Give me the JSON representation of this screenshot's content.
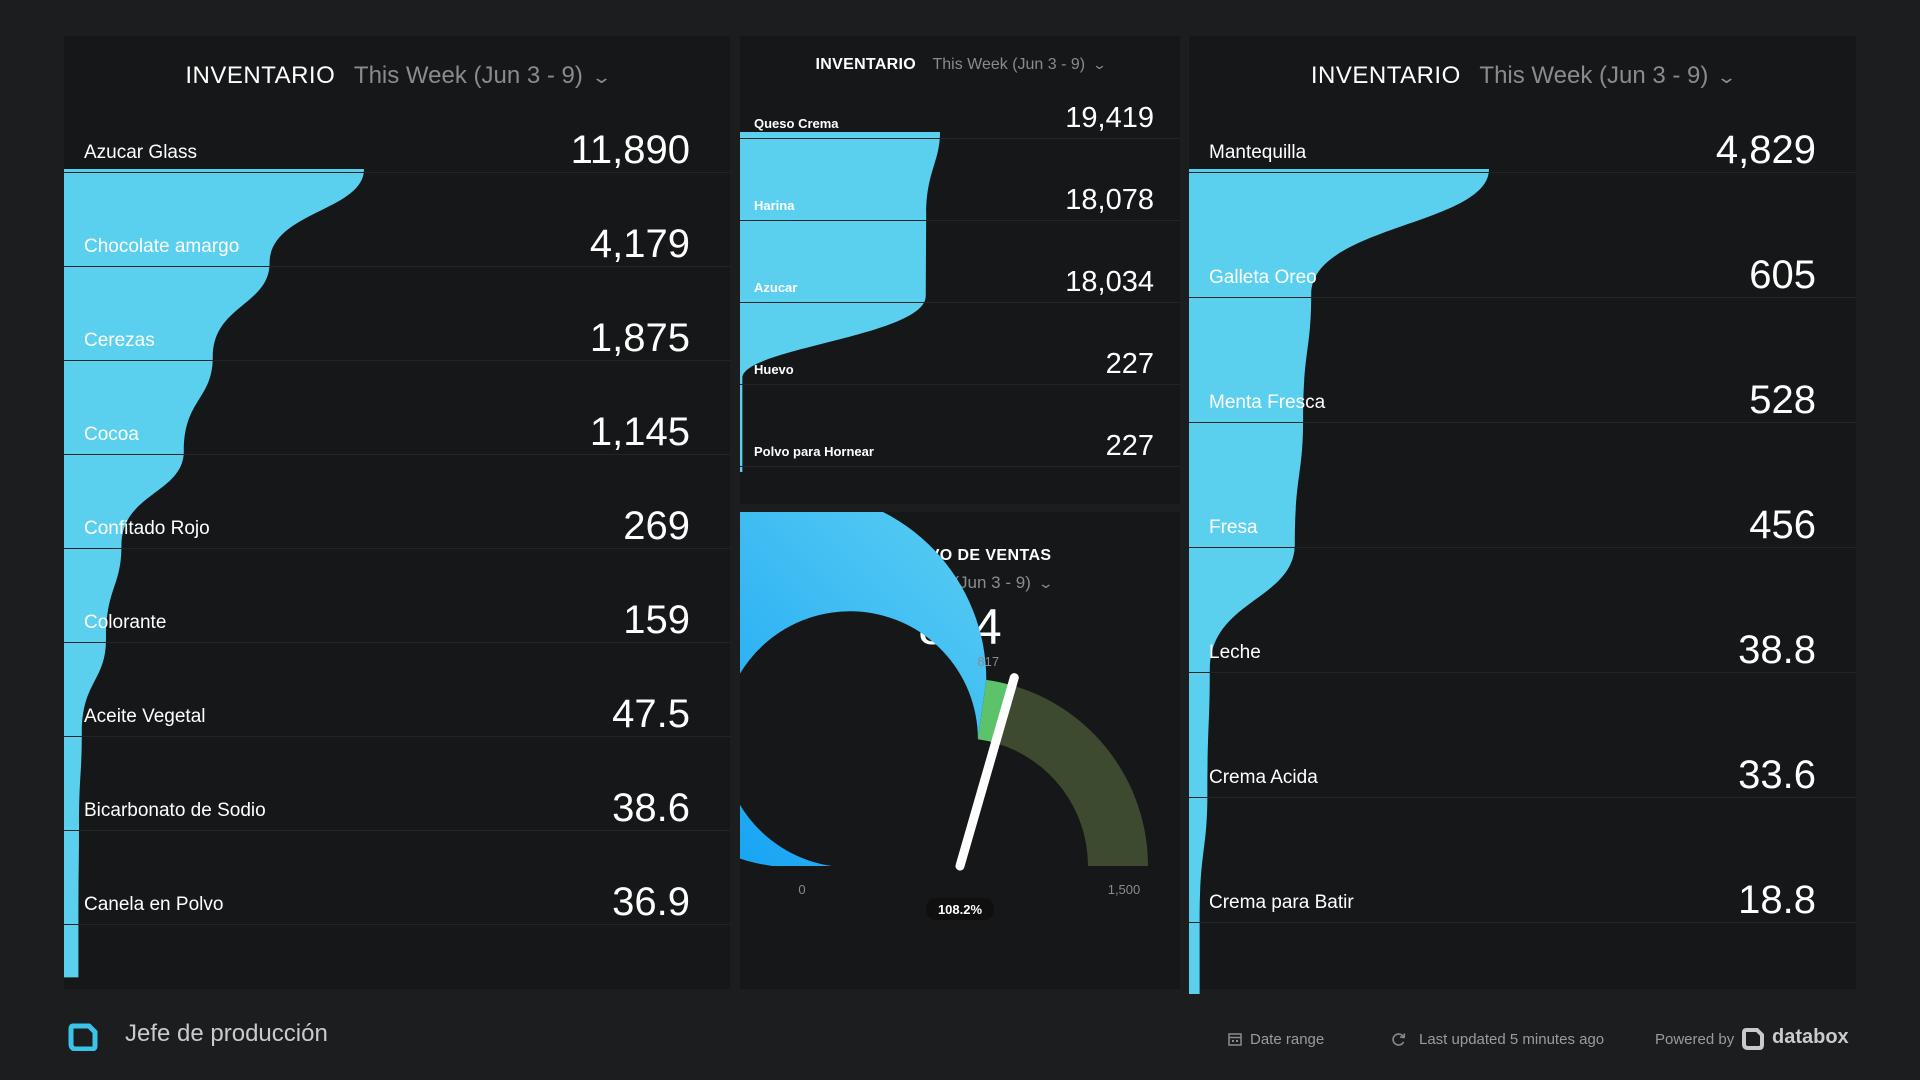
{
  "left_panel": {
    "title": "INVENTARIO",
    "date_range": "This Week (Jun 3 - 9)",
    "rows": [
      {
        "label": "Azucar Glass",
        "value": "11,890"
      },
      {
        "label": "Chocolate amargo",
        "value": "4,179"
      },
      {
        "label": "Cerezas",
        "value": "1,875"
      },
      {
        "label": "Cocoa",
        "value": "1,145"
      },
      {
        "label": "Confitado Rojo",
        "value": "269"
      },
      {
        "label": "Colorante",
        "value": "159"
      },
      {
        "label": "Aceite Vegetal",
        "value": "47.5"
      },
      {
        "label": "Bicarbonato de Sodio",
        "value": "38.6"
      },
      {
        "label": "Canela en Polvo",
        "value": "36.9"
      }
    ]
  },
  "middle_panel": {
    "title": "INVENTARIO",
    "date_range": "This Week (Jun 3 - 9)",
    "rows": [
      {
        "label": "Queso Crema",
        "value": "19,419"
      },
      {
        "label": "Harina",
        "value": "18,078"
      },
      {
        "label": "Azucar",
        "value": "18,034"
      },
      {
        "label": "Huevo",
        "value": "227"
      },
      {
        "label": "Polvo para Hornear",
        "value": "227"
      }
    ]
  },
  "gauge": {
    "title": "OBJETIVO DE VENTAS",
    "date_range": "This Week (Jun 3 - 9)",
    "value": "884",
    "value_number": 884,
    "target_label": "817",
    "target_number": 817,
    "min_label": "0",
    "min_number": 0,
    "max_label": "1,500",
    "max_number": 1500,
    "percent_label": "108.2%"
  },
  "right_panel": {
    "title": "INVENTARIO",
    "date_range": "This Week (Jun 3 - 9)",
    "rows": [
      {
        "label": "Mantequilla",
        "value": "4,829"
      },
      {
        "label": "Galleta Oreo",
        "value": "605"
      },
      {
        "label": "Menta Fresca",
        "value": "528"
      },
      {
        "label": "Fresa",
        "value": "456"
      },
      {
        "label": "Leche",
        "value": "38.8"
      },
      {
        "label": "Crema Acida",
        "value": "33.6"
      },
      {
        "label": "Crema para Batir",
        "value": "18.8"
      }
    ]
  },
  "footer": {
    "dashboard_name": "Jefe de producción",
    "date_range_label": "Date range",
    "last_updated": "Last updated 5 minutes ago",
    "powered_by": "Powered by",
    "brand": "databox"
  },
  "colors": {
    "background": "#1c1d1f",
    "panel": "#161718",
    "funnel": "#5bd0ee",
    "gauge_start": "#0a9cf5",
    "gauge_end": "#5ccff2",
    "gauge_green": "#5cc36a",
    "gauge_remaining": "#3d4a30"
  }
}
